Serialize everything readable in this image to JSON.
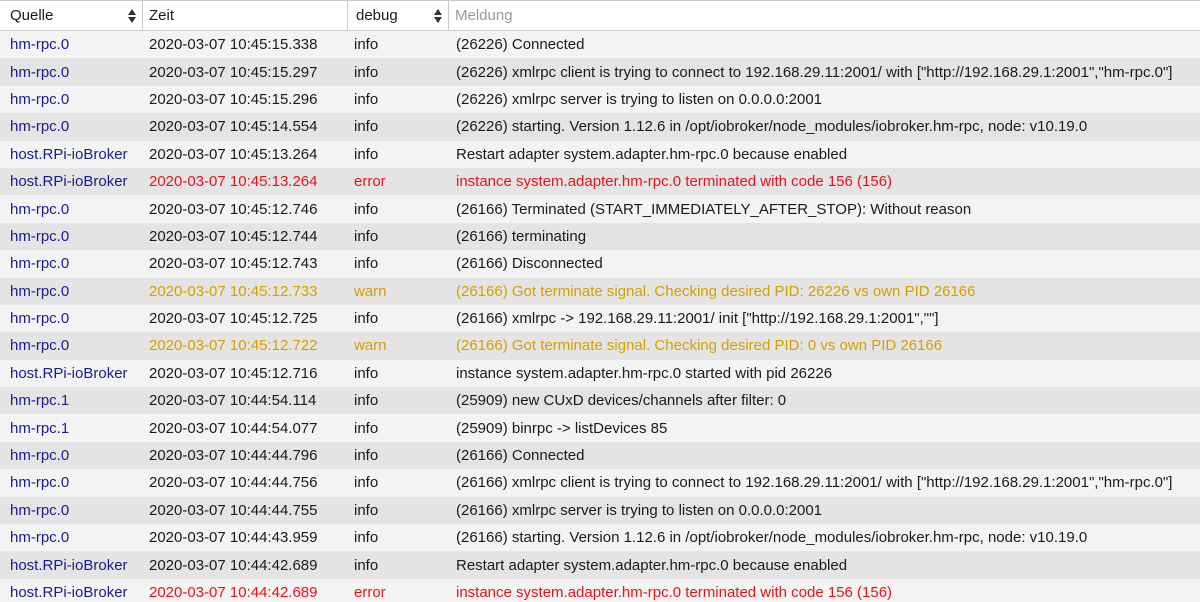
{
  "header": {
    "source_label": "Quelle",
    "time_label": "Zeit",
    "level_filter": "debug",
    "message_placeholder": "Meldung"
  },
  "colors": {
    "source_link": "#1b1b8f",
    "error": "#e8121b",
    "warn": "#d5a000"
  },
  "rows": [
    {
      "source": "hm-rpc.0",
      "time": "2020-03-07 10:45:15.338",
      "level": "info",
      "message": "(26226) Connected"
    },
    {
      "source": "hm-rpc.0",
      "time": "2020-03-07 10:45:15.297",
      "level": "info",
      "message": "(26226) xmlrpc client is trying to connect to 192.168.29.11:2001/ with [\"http://192.168.29.1:2001\",\"hm-rpc.0\"]"
    },
    {
      "source": "hm-rpc.0",
      "time": "2020-03-07 10:45:15.296",
      "level": "info",
      "message": "(26226) xmlrpc server is trying to listen on 0.0.0.0:2001"
    },
    {
      "source": "hm-rpc.0",
      "time": "2020-03-07 10:45:14.554",
      "level": "info",
      "message": "(26226) starting. Version 1.12.6 in /opt/iobroker/node_modules/iobroker.hm-rpc, node: v10.19.0"
    },
    {
      "source": "host.RPi-ioBroker",
      "time": "2020-03-07 10:45:13.264",
      "level": "info",
      "message": "Restart adapter system.adapter.hm-rpc.0 because enabled"
    },
    {
      "source": "host.RPi-ioBroker",
      "time": "2020-03-07 10:45:13.264",
      "level": "error",
      "message": "instance system.adapter.hm-rpc.0 terminated with code 156 (156)"
    },
    {
      "source": "hm-rpc.0",
      "time": "2020-03-07 10:45:12.746",
      "level": "info",
      "message": "(26166) Terminated (START_IMMEDIATELY_AFTER_STOP): Without reason"
    },
    {
      "source": "hm-rpc.0",
      "time": "2020-03-07 10:45:12.744",
      "level": "info",
      "message": "(26166) terminating"
    },
    {
      "source": "hm-rpc.0",
      "time": "2020-03-07 10:45:12.743",
      "level": "info",
      "message": "(26166) Disconnected"
    },
    {
      "source": "hm-rpc.0",
      "time": "2020-03-07 10:45:12.733",
      "level": "warn",
      "message": "(26166) Got terminate signal. Checking desired PID: 26226 vs own PID 26166"
    },
    {
      "source": "hm-rpc.0",
      "time": "2020-03-07 10:45:12.725",
      "level": "info",
      "message": "(26166) xmlrpc -> 192.168.29.11:2001/ init [\"http://192.168.29.1:2001\",\"\"]"
    },
    {
      "source": "hm-rpc.0",
      "time": "2020-03-07 10:45:12.722",
      "level": "warn",
      "message": "(26166) Got terminate signal. Checking desired PID: 0 vs own PID 26166"
    },
    {
      "source": "host.RPi-ioBroker",
      "time": "2020-03-07 10:45:12.716",
      "level": "info",
      "message": "instance system.adapter.hm-rpc.0 started with pid 26226"
    },
    {
      "source": "hm-rpc.1",
      "time": "2020-03-07 10:44:54.114",
      "level": "info",
      "message": "(25909) new CUxD devices/channels after filter: 0"
    },
    {
      "source": "hm-rpc.1",
      "time": "2020-03-07 10:44:54.077",
      "level": "info",
      "message": "(25909) binrpc -> listDevices 85"
    },
    {
      "source": "hm-rpc.0",
      "time": "2020-03-07 10:44:44.796",
      "level": "info",
      "message": "(26166) Connected"
    },
    {
      "source": "hm-rpc.0",
      "time": "2020-03-07 10:44:44.756",
      "level": "info",
      "message": "(26166) xmlrpc client is trying to connect to 192.168.29.11:2001/ with [\"http://192.168.29.1:2001\",\"hm-rpc.0\"]"
    },
    {
      "source": "hm-rpc.0",
      "time": "2020-03-07 10:44:44.755",
      "level": "info",
      "message": "(26166) xmlrpc server is trying to listen on 0.0.0.0:2001"
    },
    {
      "source": "hm-rpc.0",
      "time": "2020-03-07 10:44:43.959",
      "level": "info",
      "message": "(26166) starting. Version 1.12.6 in /opt/iobroker/node_modules/iobroker.hm-rpc, node: v10.19.0"
    },
    {
      "source": "host.RPi-ioBroker",
      "time": "2020-03-07 10:44:42.689",
      "level": "info",
      "message": "Restart adapter system.adapter.hm-rpc.0 because enabled"
    },
    {
      "source": "host.RPi-ioBroker",
      "time": "2020-03-07 10:44:42.689",
      "level": "error",
      "message": "instance system.adapter.hm-rpc.0 terminated with code 156 (156)"
    }
  ]
}
